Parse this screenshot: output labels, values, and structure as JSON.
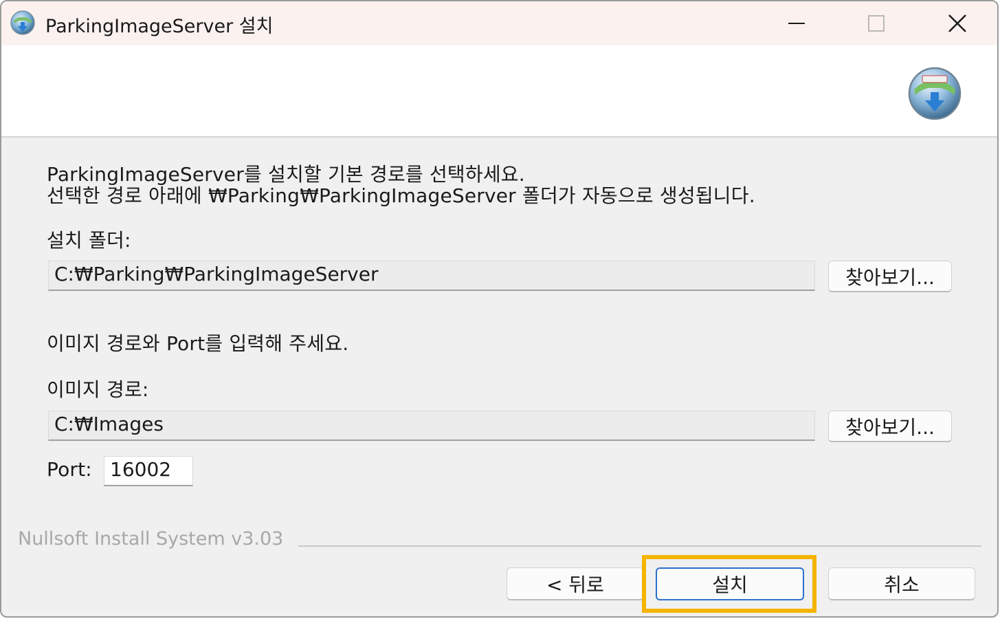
{
  "window": {
    "title": "ParkingImageServer 설치"
  },
  "instructions": {
    "line1": "ParkingImageServer를 설치할 기본 경로를 선택하세요.",
    "line2": "선택한 경로 아래에 ₩Parking₩ParkingImageServer 폴더가 자동으로 생성됩니다."
  },
  "install_folder": {
    "label": "설치 폴더:",
    "value": "C:₩Parking₩ParkingImageServer",
    "browse_label": "찾아보기..."
  },
  "image_section": {
    "prompt": "이미지 경로와 Port를 입력해 주세요.",
    "path_label": "이미지 경로:",
    "path_value": "C:₩Images",
    "browse_label": "찾아보기...",
    "port_label": "Port:",
    "port_value": "16002"
  },
  "footer": {
    "brand": "Nullsoft Install System v3.03",
    "back_label": "< 뒤로",
    "install_label": "설치",
    "cancel_label": "취소"
  },
  "colors": {
    "highlight": "#f5b400",
    "primary_border": "#2b6fd0"
  }
}
